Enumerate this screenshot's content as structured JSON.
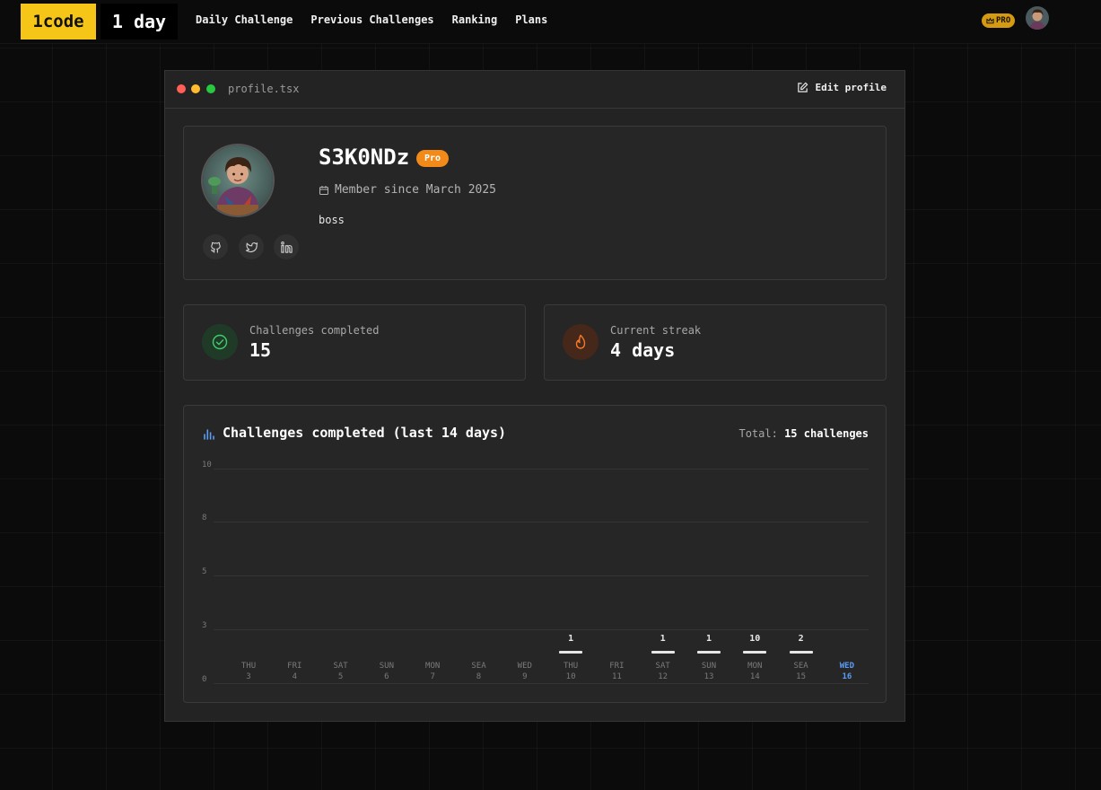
{
  "nav": {
    "logo": "1code",
    "streak": "1 day",
    "links": [
      "Daily Challenge",
      "Previous Challenges",
      "Ranking",
      "Plans"
    ],
    "pro_label": "PRO"
  },
  "window": {
    "filename": "profile.tsx",
    "edit_label": "Edit profile",
    "dot_colors": [
      "#ff5f57",
      "#febc2e",
      "#28c840"
    ]
  },
  "profile": {
    "username": "S3K0NDz",
    "badge": "Pro",
    "member_since": "Member since March 2025",
    "bio": "boss",
    "socials": [
      "github-icon",
      "twitter-icon",
      "linkedin-icon"
    ]
  },
  "stats": {
    "completed": {
      "label": "Challenges completed",
      "value": "15"
    },
    "streak": {
      "label": "Current streak",
      "value": "4 days"
    }
  },
  "chart": {
    "title": "Challenges completed (last 14 days)",
    "total_label": "Total:",
    "total_value": "15 challenges"
  },
  "chart_data": {
    "type": "bar",
    "title": "Challenges completed (last 14 days)",
    "xlabel": "",
    "ylabel": "",
    "yticks": [
      "10",
      "8",
      "5",
      "3",
      "0"
    ],
    "categories": [
      {
        "day": "THU",
        "date": "3"
      },
      {
        "day": "FRI",
        "date": "4"
      },
      {
        "day": "SAT",
        "date": "5"
      },
      {
        "day": "SUN",
        "date": "6"
      },
      {
        "day": "MON",
        "date": "7"
      },
      {
        "day": "SEA",
        "date": "8"
      },
      {
        "day": "WED",
        "date": "9"
      },
      {
        "day": "THU",
        "date": "10"
      },
      {
        "day": "FRI",
        "date": "11"
      },
      {
        "day": "SAT",
        "date": "12"
      },
      {
        "day": "SUN",
        "date": "13"
      },
      {
        "day": "MON",
        "date": "14"
      },
      {
        "day": "SEA",
        "date": "15"
      },
      {
        "day": "WED",
        "date": "16"
      }
    ],
    "values": [
      0,
      0,
      0,
      0,
      0,
      0,
      0,
      1,
      0,
      1,
      1,
      10,
      2,
      0
    ],
    "highlight_index": 13,
    "highlight_color": "#5b9cf6"
  }
}
